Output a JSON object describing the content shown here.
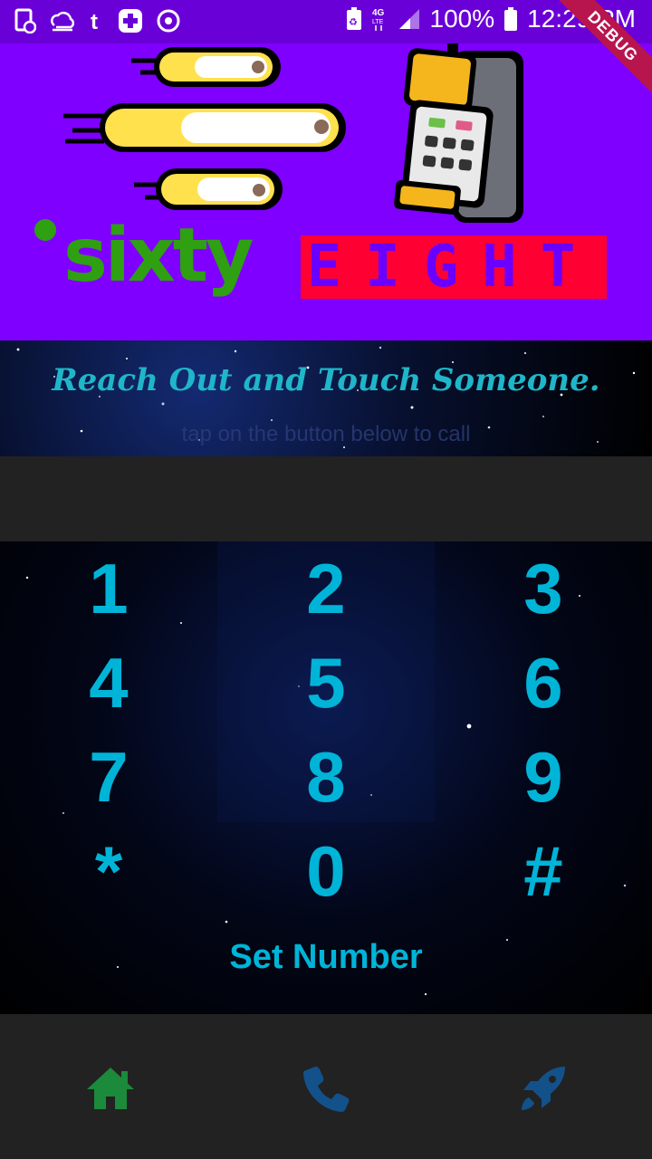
{
  "status_bar": {
    "battery_percent": "100%",
    "time": "12:29 PM",
    "network": "4G LTE"
  },
  "debug_banner": "DEBUG",
  "banner": {
    "logo_word_1": "sixty",
    "logo_word_2": "EIGHT"
  },
  "hero": {
    "tagline": "Reach Out and Touch Someone.",
    "hint": "tap on the button below to call"
  },
  "number_display": {
    "value": ""
  },
  "keypad": {
    "keys": [
      "1",
      "2",
      "3",
      "4",
      "5",
      "6",
      "7",
      "8",
      "9",
      "*",
      "0",
      "#"
    ],
    "set_number_label": "Set Number"
  },
  "bottom_nav": {
    "items": [
      {
        "icon": "home-icon",
        "color": "#1b8a3a"
      },
      {
        "icon": "phone-icon",
        "color": "#13518a"
      },
      {
        "icon": "rocket-icon",
        "color": "#13518a"
      }
    ]
  },
  "colors": {
    "status_bar": "#6a00d8",
    "banner_bg": "#7f00ff",
    "accent": "#00b4d8",
    "logo_green": "#2ea012",
    "logo_red": "#ff0033"
  }
}
